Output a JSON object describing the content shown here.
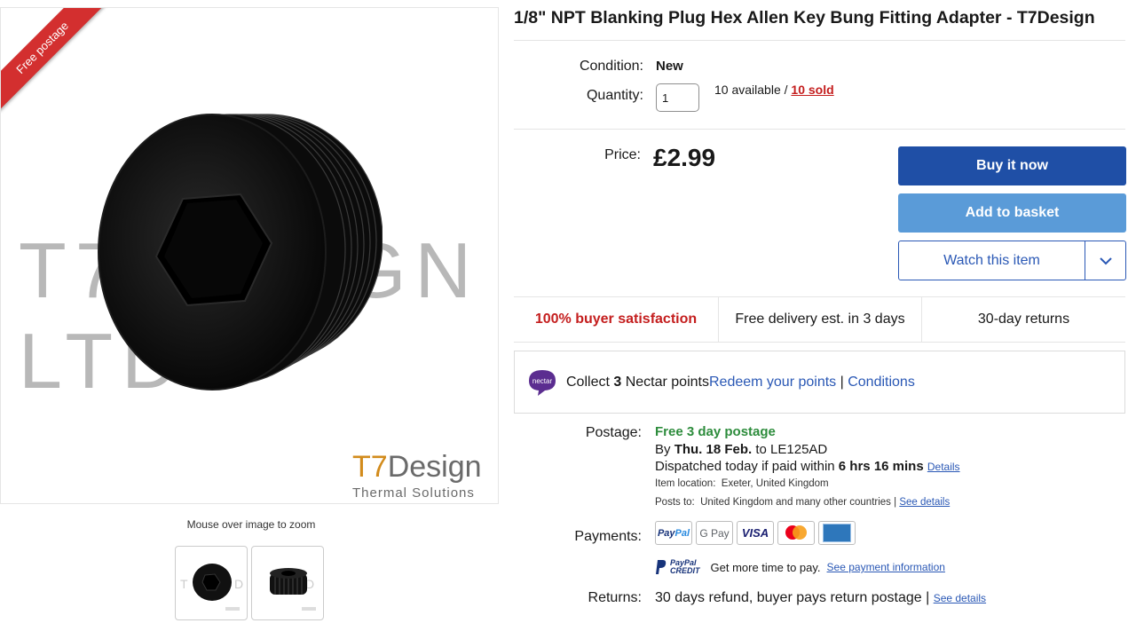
{
  "gallery": {
    "ribbon_label": "Free postage",
    "watermark_text": "T7DESIGN LTD",
    "brand_logo_name_prefix": "T7",
    "brand_logo_name_suffix": "Design",
    "brand_logo_tagline": "Thermal Solutions",
    "zoom_hint": "Mouse over image to zoom",
    "thumbnails": [
      "thumbnail-front",
      "thumbnail-side"
    ]
  },
  "listing": {
    "title": "1/8\" NPT Blanking Plug Hex Allen Key Bung Fitting Adapter - T7Design",
    "condition_label": "Condition:",
    "condition_value": "New",
    "quantity_label": "Quantity:",
    "quantity_value": "1",
    "available_text": "10 available / ",
    "sold_text": "10 sold",
    "price_label": "Price:",
    "price_value": "£2.99"
  },
  "actions": {
    "buy_now": "Buy it now",
    "add_to_basket": "Add to basket",
    "watch": "Watch this item",
    "watch_caret_icon": "chevron-down-icon"
  },
  "badges": {
    "satisfaction": "100% buyer satisfaction",
    "delivery": "Free delivery est. in 3 days",
    "returns": "30-day returns"
  },
  "nectar": {
    "logo_text": "nectar",
    "collect_prefix": "Collect ",
    "collect_points": "3",
    "collect_suffix": " Nectar points",
    "redeem_link": "Redeem your points",
    "separator": " | ",
    "conditions_link": "Conditions"
  },
  "postage": {
    "label": "Postage:",
    "free_text": "Free 3 day postage",
    "by_prefix": "By ",
    "by_date": "Thu. 18 Feb.",
    "by_suffix": " to LE125AD",
    "dispatch_prefix": "Dispatched today if paid within ",
    "dispatch_time": "6 hrs 16 mins",
    "details_link": "Details",
    "location_text": "Item location:  Exeter, United Kingdom",
    "posts_to_text": "Posts to:  United Kingdom and many other countries | ",
    "see_details_link": "See details"
  },
  "payments": {
    "label": "Payments:",
    "methods": [
      "PayPal",
      "G Pay",
      "VISA",
      "mastercard",
      "amex"
    ],
    "paypal_pay": "Pay",
    "paypal_pal": "Pal",
    "gpay": "G Pay",
    "visa": "VISA",
    "credit_line1": "PayPal",
    "credit_line2": "CREDIT",
    "credit_text": "Get more time to pay.",
    "credit_link": "See payment information"
  },
  "returns": {
    "label": "Returns:",
    "text": "30 days refund, buyer pays return postage | ",
    "see_details_link": "See details"
  },
  "colors": {
    "buy_now_bg": "#1f4fa6",
    "basket_bg": "#5a9bd8",
    "link_blue": "#2a58b5",
    "satisfaction_red": "#c41e1e",
    "free_postage_green": "#2d8c3c",
    "ribbon_red": "#d32f2f"
  }
}
